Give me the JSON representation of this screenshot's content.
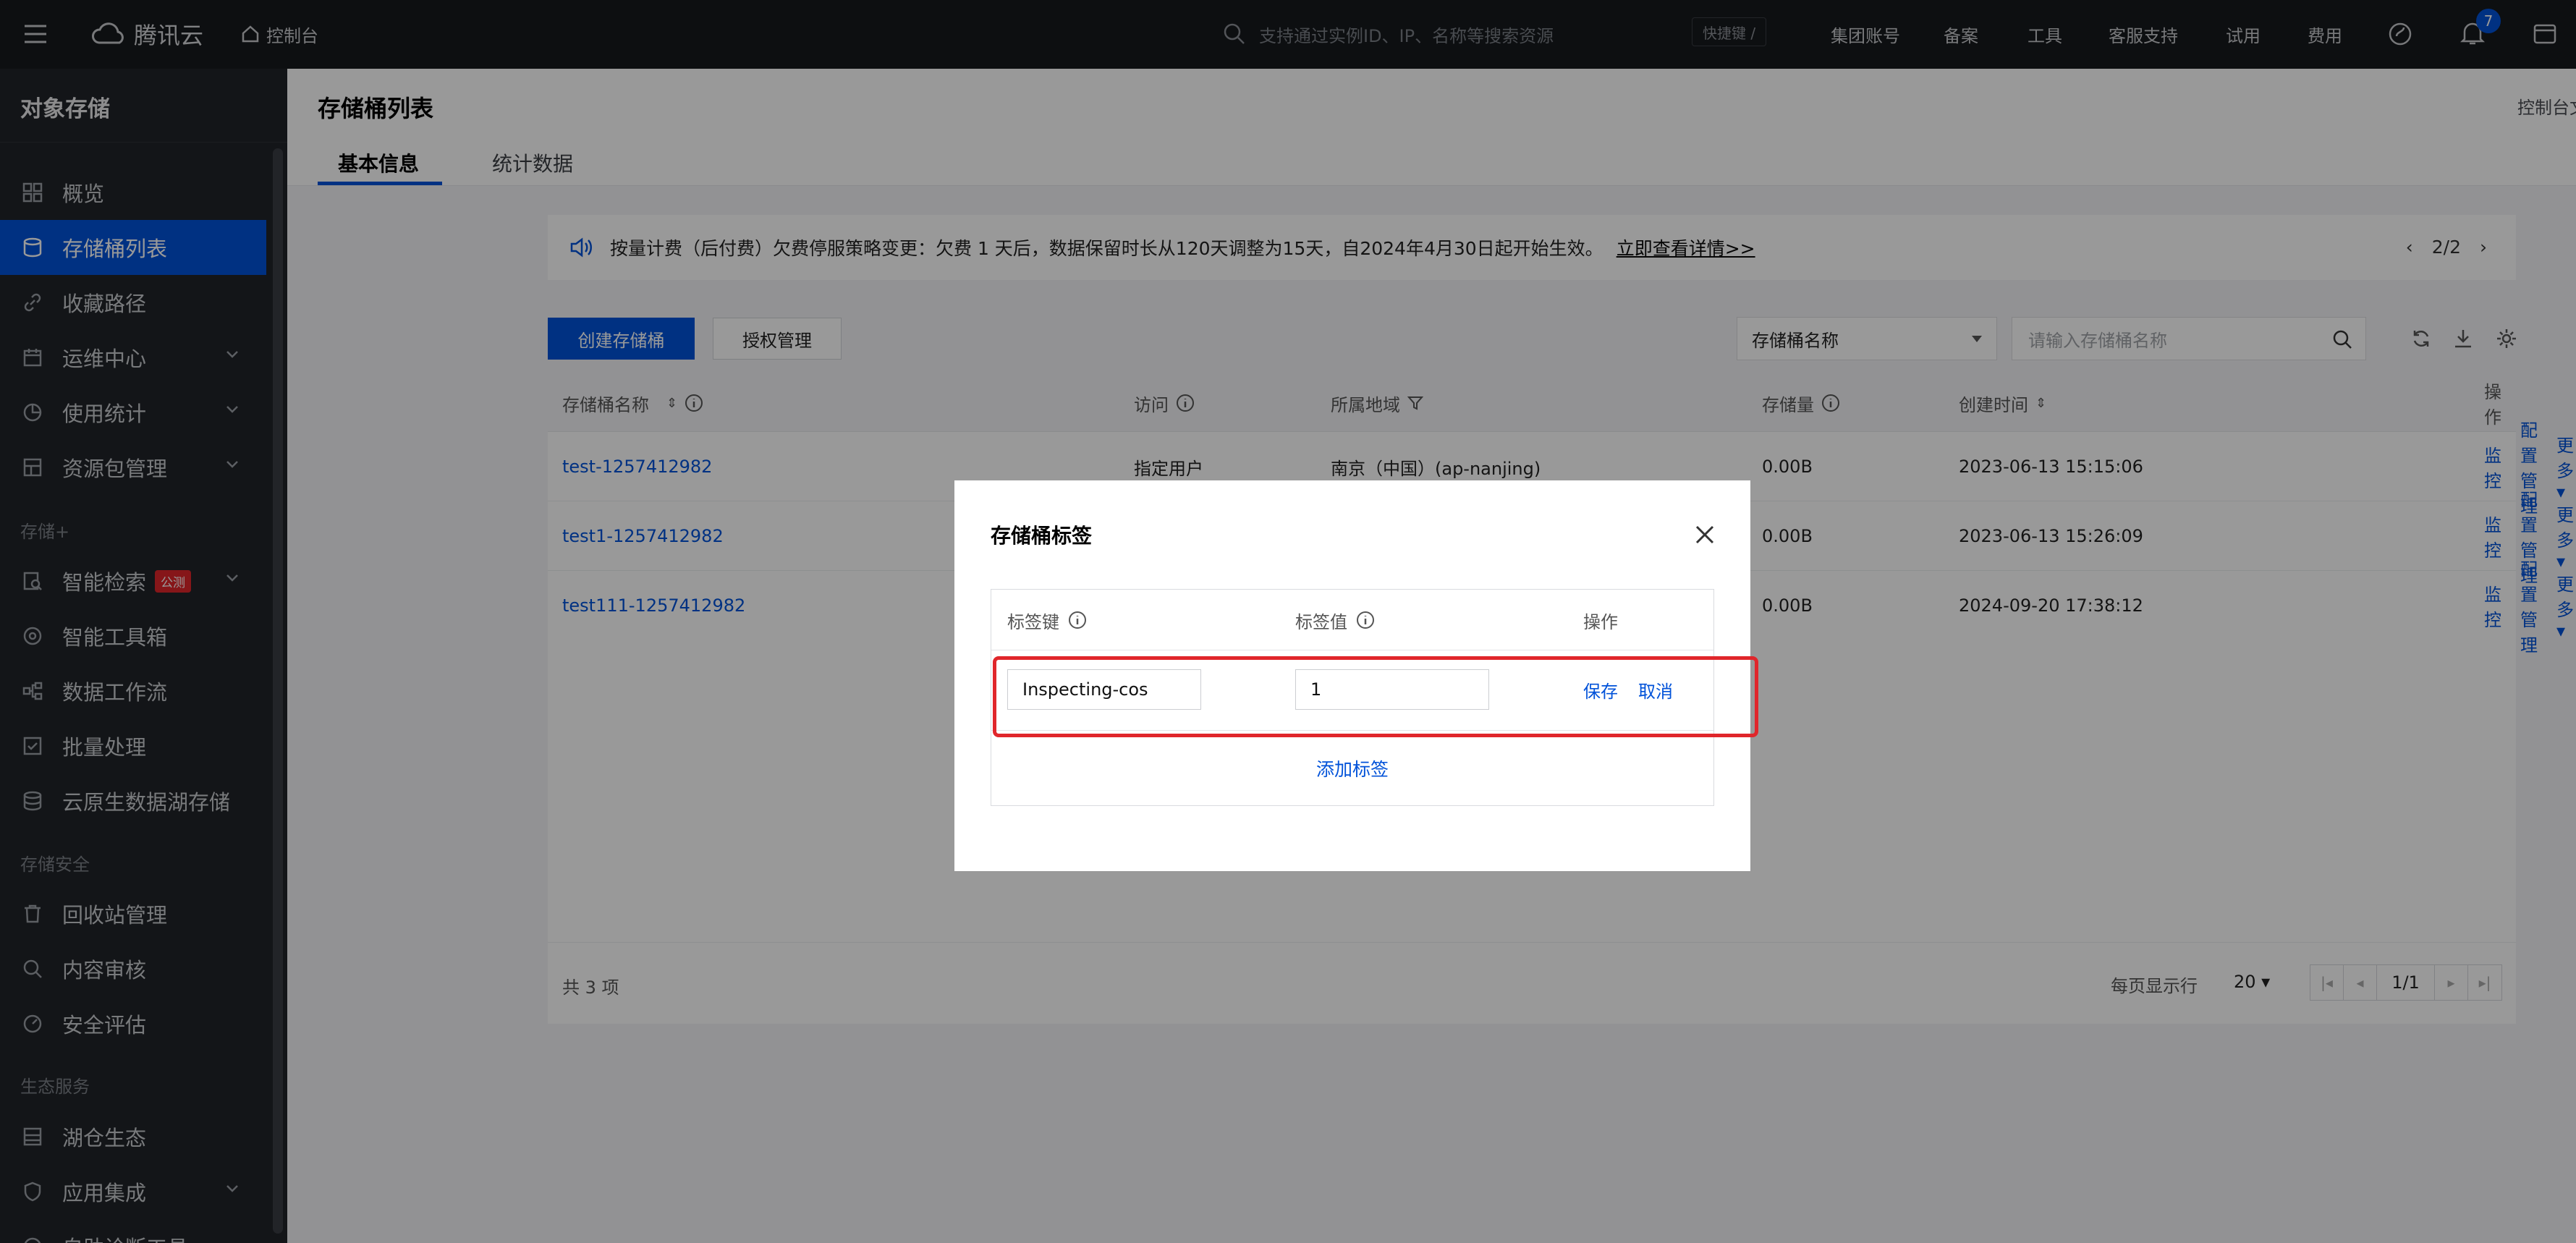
{
  "topbar": {
    "brand": "腾讯云",
    "console": "控制台",
    "search_placeholder": "支持通过实例ID、IP、名称等搜索资源",
    "shortcut": "快捷键 /",
    "links": [
      "集团账号",
      "备案",
      "工具",
      "客服支持",
      "试用",
      "费用"
    ],
    "notification_count": "7"
  },
  "sidebar": {
    "title": "对象存储",
    "items": [
      {
        "label": "概览",
        "icon": "grid-icon"
      },
      {
        "label": "存储桶列表",
        "icon": "bucket-icon"
      },
      {
        "label": "收藏路径",
        "icon": "link-icon"
      },
      {
        "label": "运维中心",
        "icon": "calendar-icon"
      },
      {
        "label": "使用统计",
        "icon": "pie-chart-icon"
      },
      {
        "label": "资源包管理",
        "icon": "package-icon"
      }
    ],
    "group_storage_plus": "存储+",
    "items2": [
      {
        "label": "智能检索",
        "icon": "search-doc-icon",
        "badge": "公测"
      },
      {
        "label": "智能工具箱",
        "icon": "toolbox-icon"
      },
      {
        "label": "数据工作流",
        "icon": "workflow-icon"
      },
      {
        "label": "批量处理",
        "icon": "checkbox-icon"
      },
      {
        "label": "云原生数据湖存储",
        "icon": "database-icon"
      }
    ],
    "group_security": "存储安全",
    "items3": [
      {
        "label": "回收站管理",
        "icon": "trash-icon"
      },
      {
        "label": "内容审核",
        "icon": "review-icon"
      },
      {
        "label": "安全评估",
        "icon": "gauge-icon"
      }
    ],
    "group_eco": "生态服务",
    "items4": [
      {
        "label": "湖仓生态",
        "icon": "lake-icon"
      },
      {
        "label": "应用集成",
        "icon": "shield-icon"
      },
      {
        "label": "自助诊断工具",
        "icon": "diagnose-icon"
      }
    ]
  },
  "main": {
    "title": "存储桶列表",
    "console_link": "控制台文",
    "tabs": [
      "基本信息",
      "统计数据"
    ],
    "notice": {
      "text": "按量计费（后付费）欠费停服策略变更：欠费 1 天后，数据保留时长从120天调整为15天，自2024年4月30日起开始生效。",
      "link": "立即查看详情>>",
      "pager": "2/2"
    },
    "buttons": {
      "create": "创建存储桶",
      "auth": "授权管理"
    },
    "filter": {
      "select": "存储桶名称",
      "placeholder": "请输入存储桶名称"
    },
    "table": {
      "columns": [
        "存储桶名称",
        "访问",
        "所属地域",
        "存储量",
        "创建时间",
        "操作"
      ],
      "rows": [
        {
          "name": "test-1257412982",
          "access": "指定用户",
          "region": "南京（中国）(ap-nanjing)",
          "size": "0.00B",
          "created": "2023-06-13 15:15:06"
        },
        {
          "name": "test1-1257412982",
          "access": "",
          "region": "",
          "size": "0.00B",
          "created": "2023-06-13 15:26:09"
        },
        {
          "name": "test111-1257412982",
          "access": "",
          "region": "",
          "size": "0.00B",
          "created": "2024-09-20 17:38:12"
        }
      ],
      "ops": [
        "监控",
        "配置管理",
        "更多"
      ],
      "total": "共 3 项",
      "per_page_label": "每页显示行",
      "per_page": "20",
      "page": "1/1"
    }
  },
  "modal": {
    "title": "存储桶标签",
    "columns": [
      "标签键",
      "标签值",
      "操作"
    ],
    "key_value": "Inspecting-cos",
    "tag_value": "1",
    "save": "保存",
    "cancel": "取消",
    "add": "添加标签"
  },
  "colors": {
    "primary": "#0052d9",
    "highlight": "#e0262b",
    "topbar": "#17191d",
    "sidebar": "#212328"
  }
}
